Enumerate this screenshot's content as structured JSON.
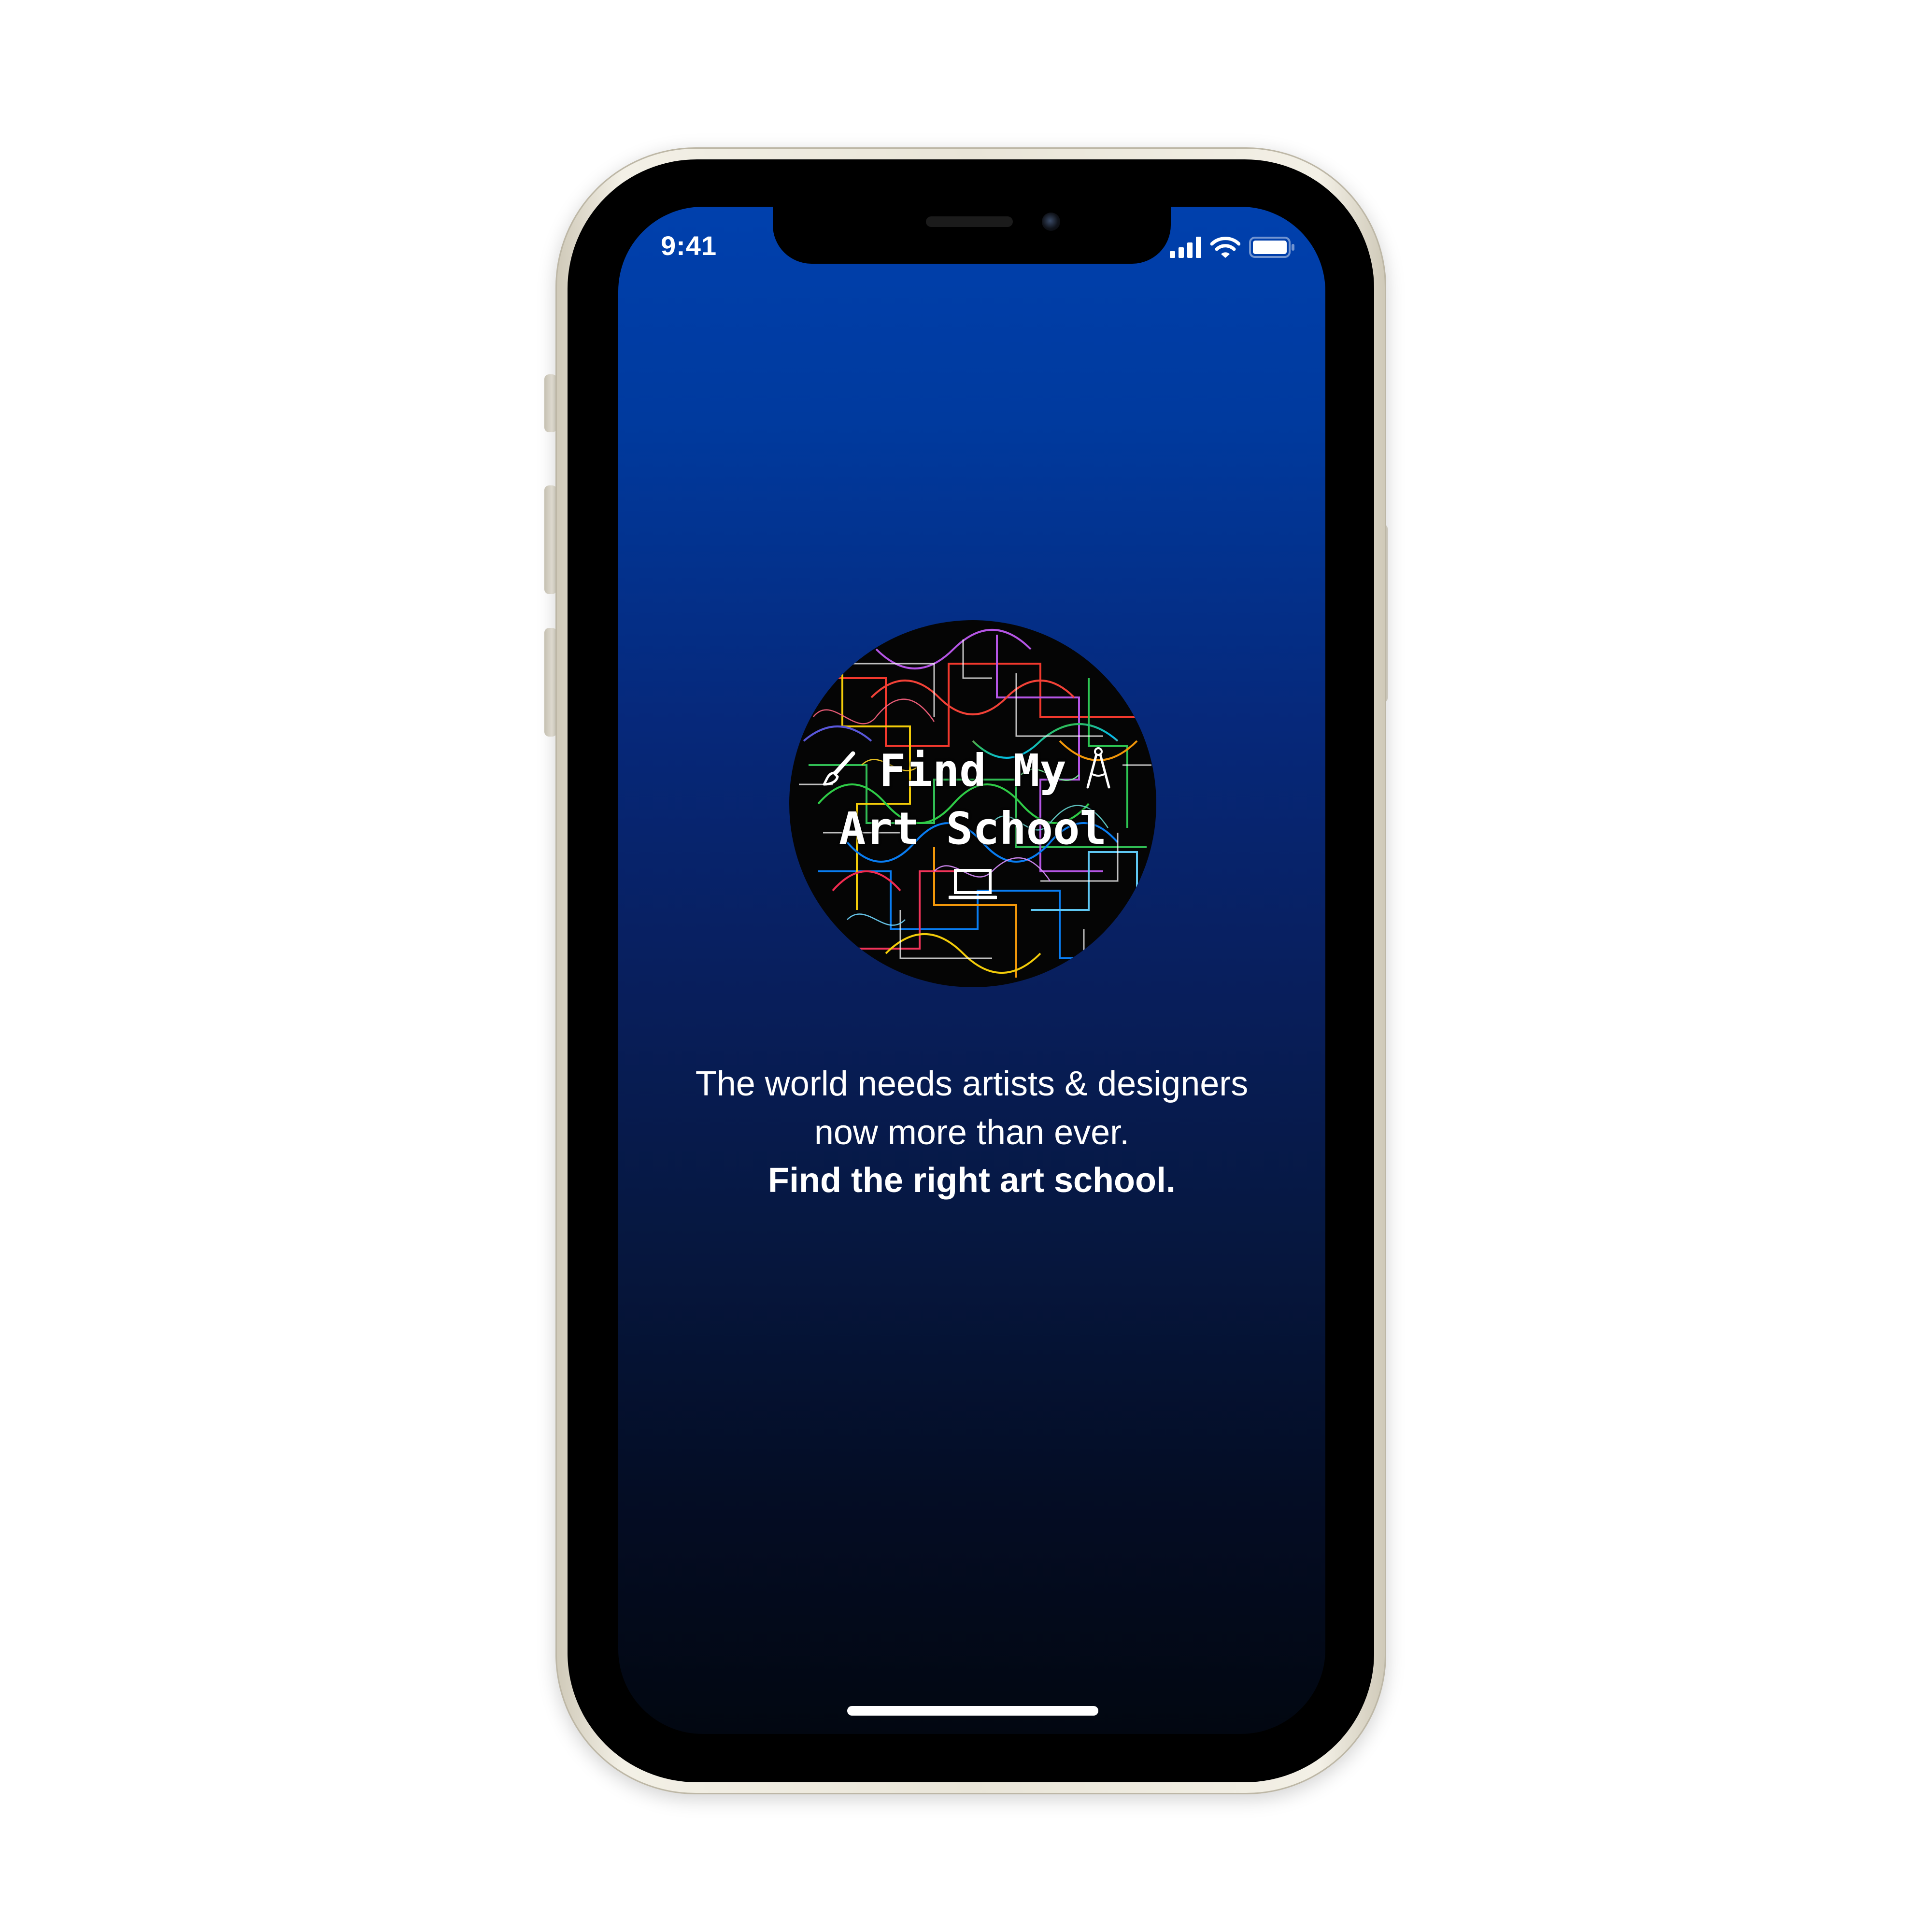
{
  "status_bar": {
    "time": "9:41",
    "icons": [
      "cellular-signal-icon",
      "wifi-icon",
      "battery-icon"
    ]
  },
  "logo": {
    "title_line1": "Find My",
    "title_line2": "Art School",
    "icons": [
      "paintbrush-icon",
      "compass-icon",
      "laptop-icon"
    ]
  },
  "tagline": {
    "line1": "The world needs artists & designers",
    "line2": "now more than ever.",
    "line3": "Find the right art school."
  },
  "colors": {
    "gradient_top": "#0040ad",
    "gradient_bottom": "#020711",
    "text": "#ffffff",
    "frame": "#ece8dc"
  }
}
